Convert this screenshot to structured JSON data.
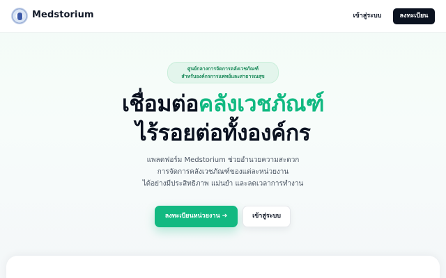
{
  "header": {
    "brand": "Medstorium",
    "login_label": "เข้าสู่ระบบ",
    "register_label": "ลงทะเบียน"
  },
  "hero": {
    "pill_line1": "ศูนย์กลางการจัดการคลังเวชภัณฑ์",
    "pill_line2": "สำหรับองค์กรการแพทย์และสาธารณสุข",
    "title_part1": "เชื่อมต่อ",
    "title_accent": "คลังเวชภัณฑ์",
    "title_line2": "ไร้รอยต่อทั้งองค์กร",
    "sub_line1": "แพลตฟอร์ม Medstorium ช่วยอำนวยความสะดวก",
    "sub_line2": "การจัดการคลังเวชภัณฑ์ของแต่ละหน่วยงาน",
    "sub_line3": "ได้อย่างมีประสิทธิภาพ แม่นยำ และลดเวลาการทำงาน",
    "primary_cta": "ลงทะเบียนหน่วยงาน ➔",
    "secondary_cta": "เข้าสู่ระบบ"
  },
  "colors": {
    "accent": "#10b981",
    "dark": "#0b1220"
  }
}
